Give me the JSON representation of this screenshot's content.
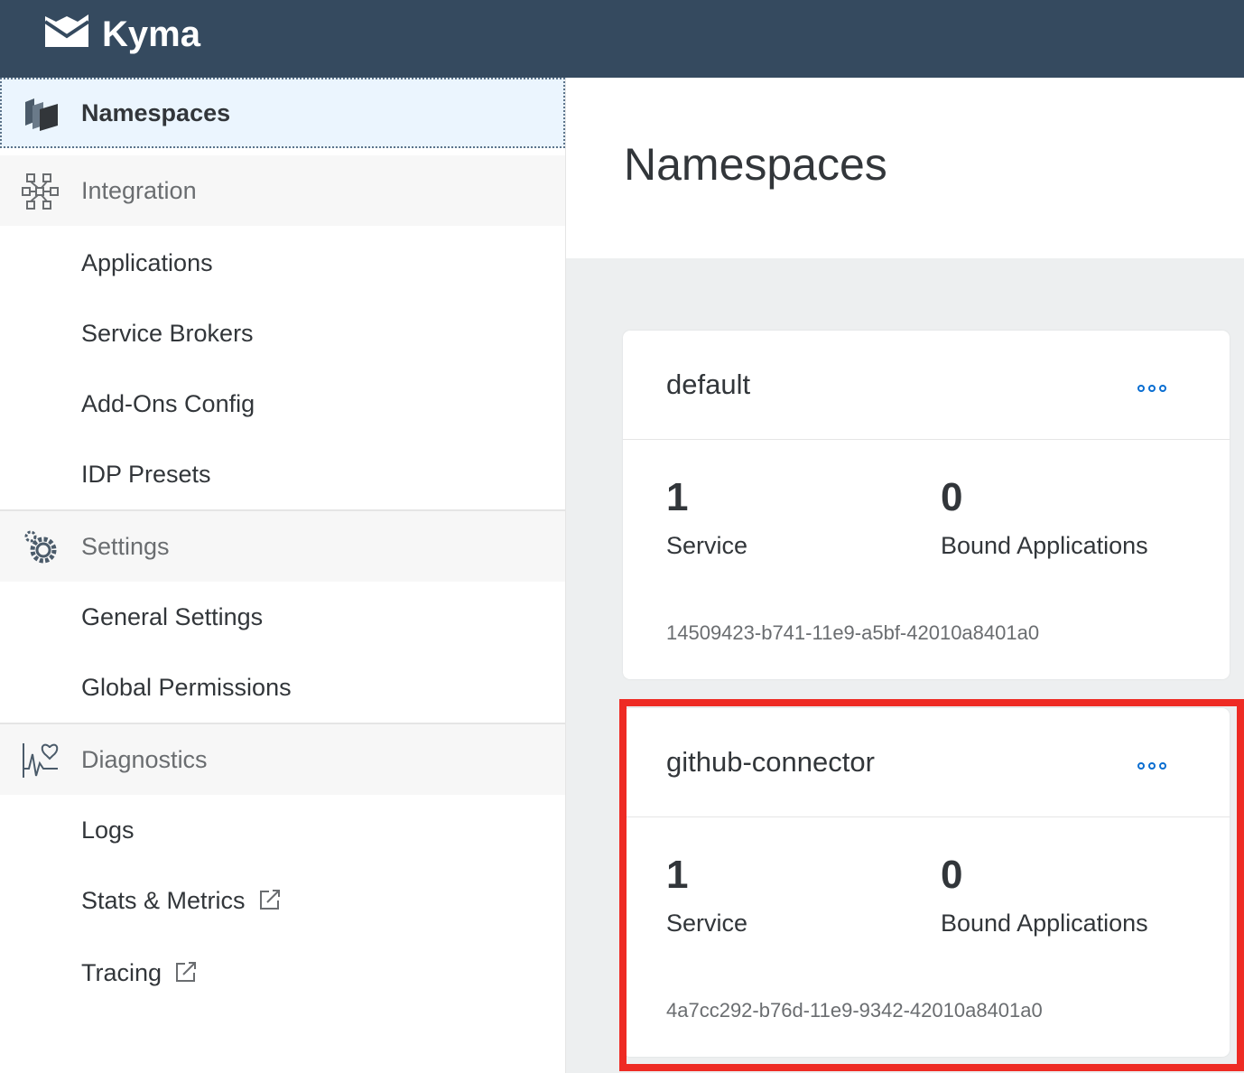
{
  "shell": {
    "brand": "Kyma",
    "logo_icon": "kyma-logo-icon"
  },
  "sidebar": {
    "items": [
      {
        "label": "Namespaces",
        "type": "top",
        "selected": true,
        "icon": "namespaces-icon"
      },
      {
        "label": "Integration",
        "type": "group",
        "icon": "integration-icon"
      },
      {
        "label": "Applications",
        "type": "child"
      },
      {
        "label": "Service Brokers",
        "type": "child"
      },
      {
        "label": "Add-Ons Config",
        "type": "child"
      },
      {
        "label": "IDP Presets",
        "type": "child"
      },
      {
        "label": "Settings",
        "type": "group",
        "icon": "settings-gear-icon"
      },
      {
        "label": "General Settings",
        "type": "child"
      },
      {
        "label": "Global Permissions",
        "type": "child"
      },
      {
        "label": "Diagnostics",
        "type": "group",
        "icon": "diagnostics-heart-icon"
      },
      {
        "label": "Logs",
        "type": "child"
      },
      {
        "label": "Stats & Metrics",
        "type": "child",
        "external": true,
        "icon": "external-link-icon"
      },
      {
        "label": "Tracing",
        "type": "child",
        "external": true,
        "icon": "external-link-icon"
      }
    ]
  },
  "main": {
    "title": "Namespaces",
    "cards": [
      {
        "name": "default",
        "services_count": "1",
        "services_label": "Service",
        "bound_count": "0",
        "bound_label": "Bound Applications",
        "uid": "14509423-b741-11e9-a5bf-42010a8401a0",
        "menu_icon": "more-options-icon"
      },
      {
        "name": "github-connector",
        "services_count": "1",
        "services_label": "Service",
        "bound_count": "0",
        "bound_label": "Bound Applications",
        "uid": "4a7cc292-b76d-11e9-9342-42010a8401a0",
        "menu_icon": "more-options-icon",
        "highlighted": true
      }
    ]
  },
  "colors": {
    "shell_bg": "#354a5f",
    "selected_bg": "#ebf5fe",
    "accent_blue": "#0a6ed1",
    "highlight_red": "#ee2b24",
    "content_bg": "#edeff0"
  }
}
